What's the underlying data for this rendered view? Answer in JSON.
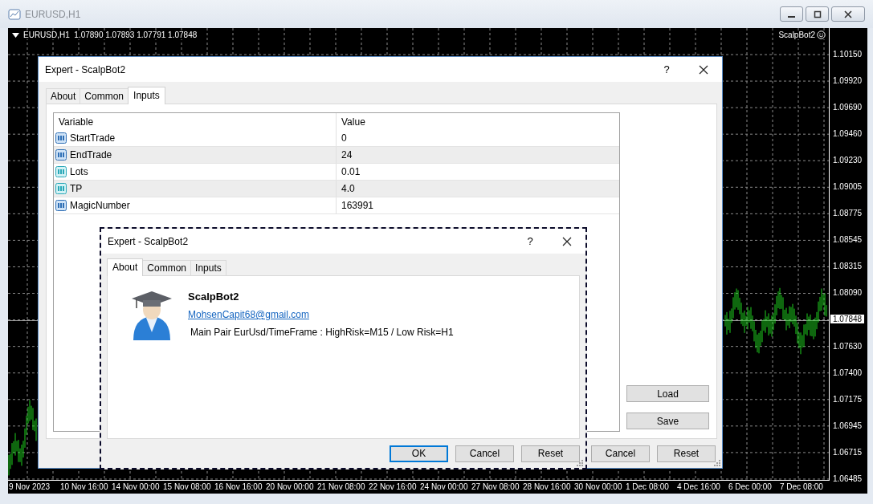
{
  "window": {
    "title": "EURUSD,H1"
  },
  "chart": {
    "symbol_info": "EURUSD,H1  1.07890 1.07893 1.07791 1.07848",
    "expert": "ScalpBot2",
    "price_labels": [
      {
        "label": "1.10150",
        "current": false
      },
      {
        "label": "1.09920",
        "current": false
      },
      {
        "label": "1.09690",
        "current": false
      },
      {
        "label": "1.09460",
        "current": false
      },
      {
        "label": "1.09230",
        "current": false
      },
      {
        "label": "1.09005",
        "current": false
      },
      {
        "label": "1.08775",
        "current": false
      },
      {
        "label": "1.08545",
        "current": false
      },
      {
        "label": "1.08315",
        "current": false
      },
      {
        "label": "1.08090",
        "current": false
      },
      {
        "label": "1.07848",
        "current": true
      },
      {
        "label": "1.07630",
        "current": false
      },
      {
        "label": "1.07400",
        "current": false
      },
      {
        "label": "1.07175",
        "current": false
      },
      {
        "label": "1.06945",
        "current": false
      },
      {
        "label": "1.06715",
        "current": false
      },
      {
        "label": "1.06485",
        "current": false
      }
    ],
    "time_labels": [
      "9 Nov 2023",
      "10 Nov 16:00",
      "14 Nov 00:00",
      "15 Nov 08:00",
      "16 Nov 16:00",
      "20 Nov 00:00",
      "21 Nov 08:00",
      "22 Nov 16:00",
      "24 Nov 00:00",
      "27 Nov 08:00",
      "28 Nov 16:00",
      "30 Nov 00:00",
      "1 Dec 08:00",
      "4 Dec 16:00",
      "6 Dec 00:00",
      "7 Dec 08:00"
    ]
  },
  "dialogs": [
    {
      "kind": "inputs",
      "focused": false,
      "title": "Expert - ScalpBot2",
      "help": "?",
      "tabs": [
        {
          "label": "About",
          "selected": false
        },
        {
          "label": "Common",
          "selected": false
        },
        {
          "label": "Inputs",
          "selected": true
        }
      ],
      "table": {
        "columns": [
          "Variable",
          "Value"
        ],
        "rows": [
          {
            "kind": "integer",
            "name": "StartTrade",
            "value": "0"
          },
          {
            "kind": "integer",
            "name": "EndTrade",
            "value": "24"
          },
          {
            "kind": "double",
            "name": "Lots",
            "value": "0.01"
          },
          {
            "kind": "double",
            "name": "TP",
            "value": "4.0"
          },
          {
            "kind": "integer",
            "name": "MagicNumber",
            "value": "163991"
          }
        ]
      },
      "side_buttons": [
        "Load",
        "Save"
      ],
      "buttons": [
        {
          "label": "Cancel",
          "default": false
        },
        {
          "label": "Reset",
          "default": false
        }
      ]
    },
    {
      "kind": "about",
      "focused": true,
      "title": "Expert - ScalpBot2",
      "help": "?",
      "tabs": [
        {
          "label": "About",
          "selected": true
        },
        {
          "label": "Common",
          "selected": false
        },
        {
          "label": "Inputs",
          "selected": false
        }
      ],
      "about": {
        "name": "ScalpBot2",
        "email": "MohsenCapit68@gmail.com",
        "description": "Main Pair EurUsd/TimeFrame : HighRisk=M15 / Low Risk=H1"
      },
      "buttons": [
        {
          "label": "OK",
          "default": true
        },
        {
          "label": "Cancel",
          "default": false
        },
        {
          "label": "Reset",
          "default": false
        }
      ]
    }
  ]
}
